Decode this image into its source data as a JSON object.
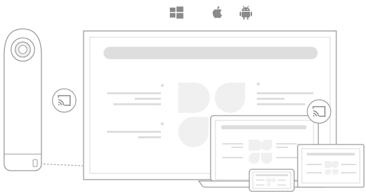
{
  "platforms": [
    {
      "name": "windows",
      "icon": "windows-logo-icon"
    },
    {
      "name": "apple",
      "icon": "apple-logo-icon"
    },
    {
      "name": "android",
      "icon": "android-logo-icon"
    }
  ],
  "cast_icons": [
    "cast-icon",
    "cast-icon"
  ],
  "devices": [
    "speaker-camera",
    "display",
    "laptop",
    "monitor",
    "tablet"
  ],
  "colors": {
    "stroke": "#9a9a9a",
    "fill_light": "#f0f0f0",
    "placeholder": "#dedede",
    "icon_gray": "#8a8a8a"
  }
}
